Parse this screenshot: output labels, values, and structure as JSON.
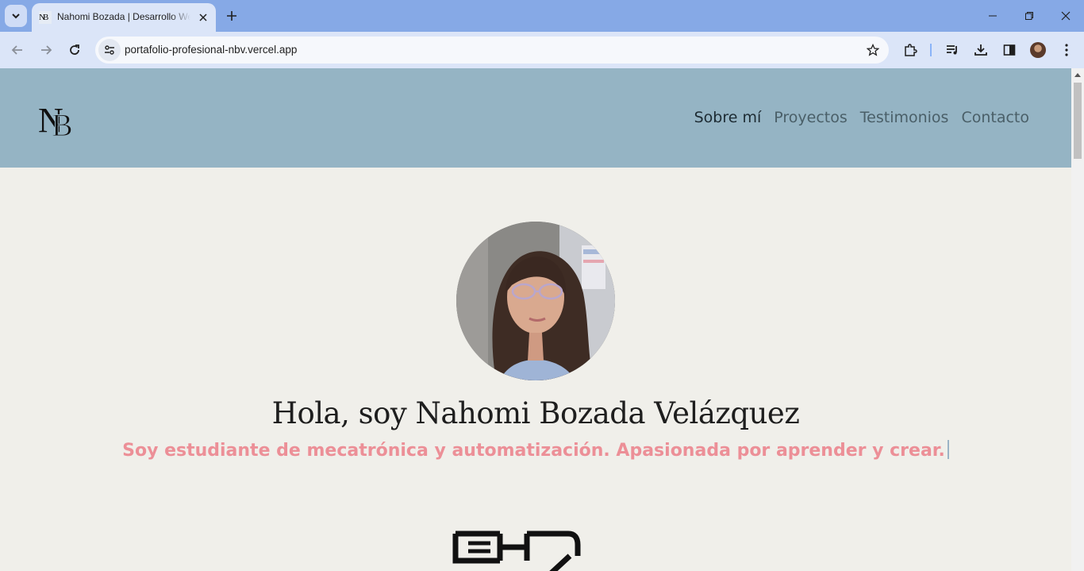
{
  "browser": {
    "tab": {
      "favicon_text": "NB",
      "title": "Nahomi Bozada | Desarrollo Web"
    },
    "url": "portafolio-profesional-nbv.vercel.app"
  },
  "site": {
    "logo_text": "NB",
    "nav": [
      {
        "label": "Sobre mí",
        "active": true
      },
      {
        "label": "Proyectos",
        "active": false
      },
      {
        "label": "Testimonios",
        "active": false
      },
      {
        "label": "Contacto",
        "active": false
      }
    ],
    "hero": {
      "title": "Hola, soy Nahomi Bozada Velázquez",
      "subtitle": "Soy estudiante de mecatrónica y automatización. Apasionada por aprender y crear."
    }
  },
  "colors": {
    "header_bg": "#95b4c4",
    "page_bg": "#f0efea",
    "subtitle": "#ec8f97",
    "tab_strip": "#86a9e6"
  },
  "icons": [
    "tab-search-icon",
    "close-icon",
    "plus-icon",
    "minimize-icon",
    "restore-icon",
    "back-icon",
    "forward-icon",
    "reload-icon",
    "site-info-icon",
    "star-icon",
    "extensions-icon",
    "media-icon",
    "download-icon",
    "side-panel-icon",
    "menu-icon"
  ]
}
